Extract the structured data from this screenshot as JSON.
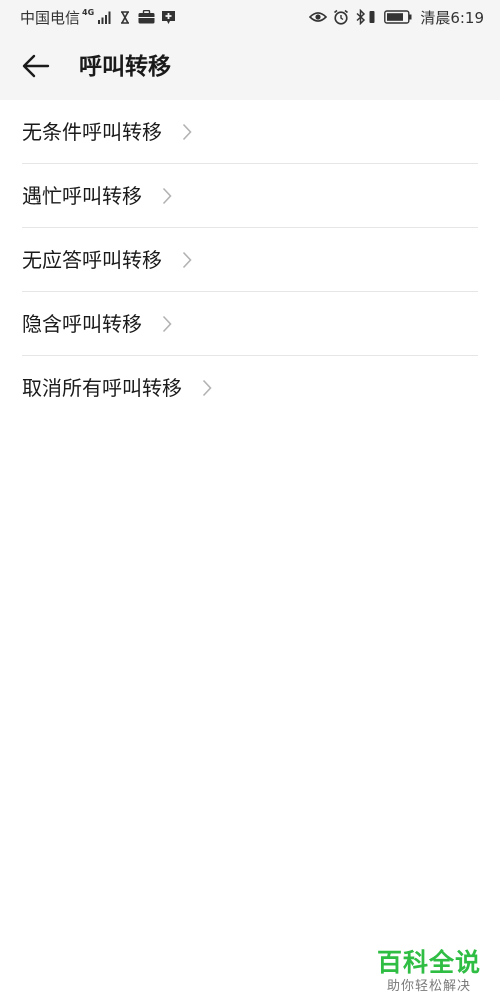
{
  "status_bar": {
    "carrier": "中国电信",
    "network_type": "4G",
    "time": "清晨6:19",
    "left_icons": [
      "signal-icon",
      "hourglass-icon",
      "briefcase-icon",
      "plus-badge-icon"
    ],
    "right_icons": [
      "eye-icon",
      "alarm-icon",
      "bluetooth-icon",
      "battery-icon"
    ]
  },
  "app_bar": {
    "title": "呼叫转移",
    "back_icon": "arrow-left-icon"
  },
  "menu": {
    "items": [
      {
        "label": "无条件呼叫转移"
      },
      {
        "label": "遇忙呼叫转移"
      },
      {
        "label": "无应答呼叫转移"
      },
      {
        "label": "隐含呼叫转移"
      },
      {
        "label": "取消所有呼叫转移"
      }
    ],
    "chevron_icon": "chevron-right-icon"
  },
  "watermark": {
    "title": "百科全说",
    "subtitle": "助你轻松解决"
  },
  "colors": {
    "header_bg": "#f5f5f5",
    "divider": "#e6e6e6",
    "watermark_green": "#2fbd44",
    "chevron": "#b3b3b3"
  }
}
